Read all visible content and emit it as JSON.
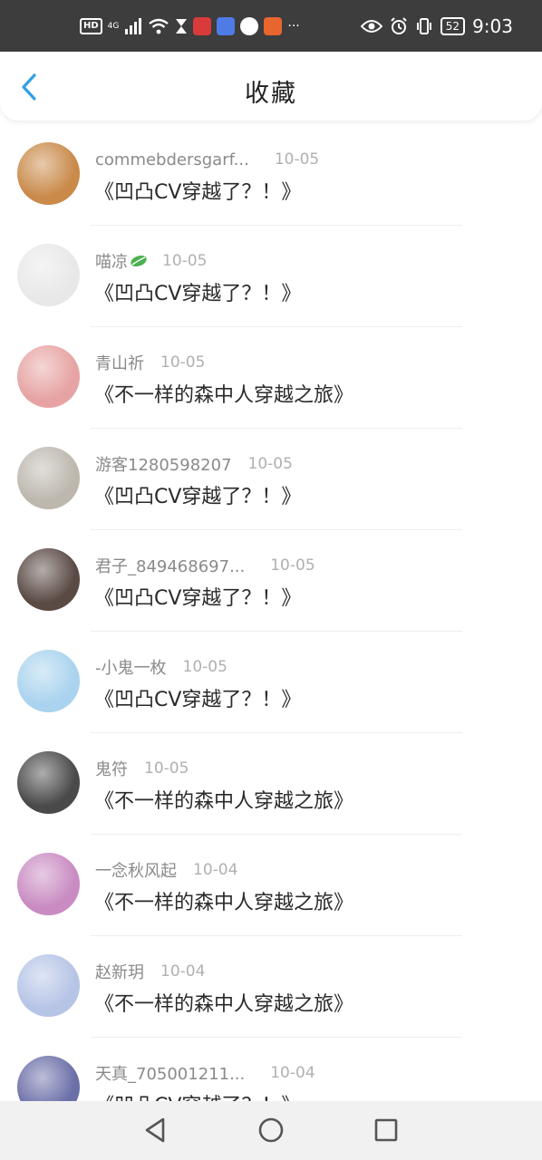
{
  "status_bar": {
    "hd": "HD",
    "network": "4G",
    "battery": "52",
    "time": "9:03",
    "more": "···",
    "icons": [
      "signal-icon",
      "wifi-icon",
      "hourglass-icon",
      "app-red-icon",
      "app-blue-icon",
      "app-globe-icon",
      "app-orange-icon",
      "eye-icon",
      "alarm-icon",
      "vibrate-icon",
      "battery-icon"
    ]
  },
  "header": {
    "title": "收藏",
    "back_icon": "back-chevron-icon",
    "accent": "#2ea1e8"
  },
  "items": [
    {
      "username": "commebdersgarf...",
      "date": "10-05",
      "book": "《凹凸CV穿越了？！》",
      "avatar_color": "#c98a4a"
    },
    {
      "username": "喵凉",
      "date": "10-05",
      "book": "《凹凸CV穿越了？！》",
      "avatar_color": "#e8e8e8",
      "badge_icon": "leaf-icon"
    },
    {
      "username": "青山祈",
      "date": "10-05",
      "book": "《不一样的森中人穿越之旅》",
      "avatar_color": "#e7a3a3"
    },
    {
      "username": "游客1280598207",
      "date": "10-05",
      "book": "《凹凸CV穿越了？！》",
      "avatar_color": "#bdb7ae"
    },
    {
      "username": "君子_849468697...",
      "date": "10-05",
      "book": "《凹凸CV穿越了？！》",
      "avatar_color": "#5a4a44"
    },
    {
      "username": "-小鬼一枚",
      "date": "10-05",
      "book": "《凹凸CV穿越了？！》",
      "avatar_color": "#a9d3ee"
    },
    {
      "username": "鬼符",
      "date": "10-05",
      "book": "《不一样的森中人穿越之旅》",
      "avatar_color": "#4a4a4a"
    },
    {
      "username": "一念秋风起",
      "date": "10-04",
      "book": "《不一样的森中人穿越之旅》",
      "avatar_color": "#c98bc2"
    },
    {
      "username": "赵新玥",
      "date": "10-04",
      "book": "《不一样的森中人穿越之旅》",
      "avatar_color": "#b6c4e6"
    },
    {
      "username": "天真_705001211...",
      "date": "10-04",
      "book": "《凹凸CV穿越了？！》",
      "avatar_color": "#6b6fa8"
    }
  ],
  "nav_bar": {
    "icons": [
      "back-triangle-icon",
      "home-circle-icon",
      "recents-square-icon"
    ]
  }
}
